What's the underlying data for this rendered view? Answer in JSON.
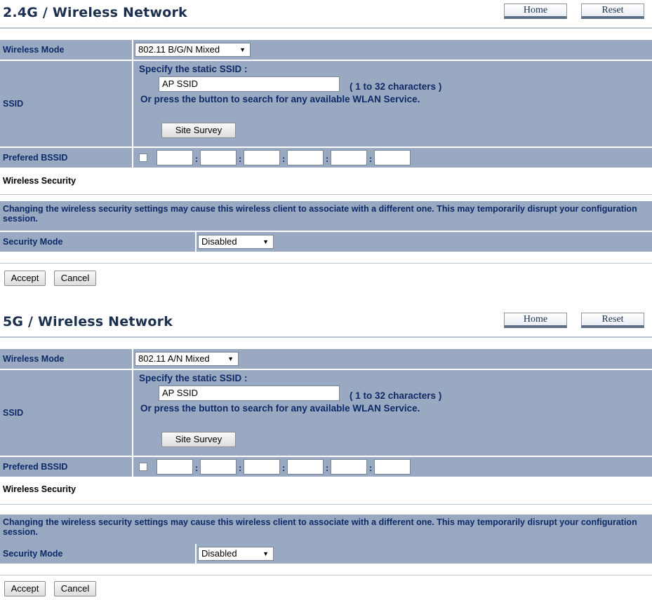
{
  "sections": [
    {
      "title": "2.4G / Wireless Network",
      "home_label": "Home",
      "reset_label": "Reset",
      "wireless_mode_label": "Wireless Mode",
      "wireless_mode_value": "802.11 B/G/N Mixed",
      "ssid_label": "SSID",
      "ssid_specify_text": "Specify the static SSID :",
      "ssid_value": "AP SSID",
      "ssid_hint": "( 1 to 32 characters )",
      "ssid_search_text": "Or press the button to search for any available WLAN Service.",
      "site_survey_label": "Site Survey",
      "prefered_bssid_label": "Prefered BSSID",
      "wireless_security_heading": "Wireless Security",
      "security_warning": "Changing the wireless security settings may cause this wireless client to associate with a different one. This may temporarily disrupt your configuration session.",
      "security_mode_label": "Security Mode",
      "security_mode_value": "Disabled",
      "accept_label": "Accept",
      "cancel_label": "Cancel"
    },
    {
      "title": "5G / Wireless Network",
      "home_label": "Home",
      "reset_label": "Reset",
      "wireless_mode_label": "Wireless Mode",
      "wireless_mode_value": "802.11 A/N Mixed",
      "ssid_label": "SSID",
      "ssid_specify_text": "Specify the static SSID :",
      "ssid_value": "AP SSID",
      "ssid_hint": "( 1 to 32 characters )",
      "ssid_search_text": "Or press the button to search for any available WLAN Service.",
      "site_survey_label": "Site Survey",
      "prefered_bssid_label": "Prefered BSSID",
      "wireless_security_heading": "Wireless Security",
      "security_warning": "Changing the wireless security settings may cause this wireless client to associate with a different one. This may temporarily disrupt your configuration session.",
      "security_mode_label": "Security Mode",
      "security_mode_value": "Disabled",
      "accept_label": "Accept",
      "cancel_label": "Cancel"
    }
  ],
  "colors": {
    "row_bg": "#9aa9c2",
    "label_text": "#0d2a66",
    "title_text": "#1b2f4e"
  },
  "icons": {
    "dropdown": "chevron-down-icon"
  }
}
